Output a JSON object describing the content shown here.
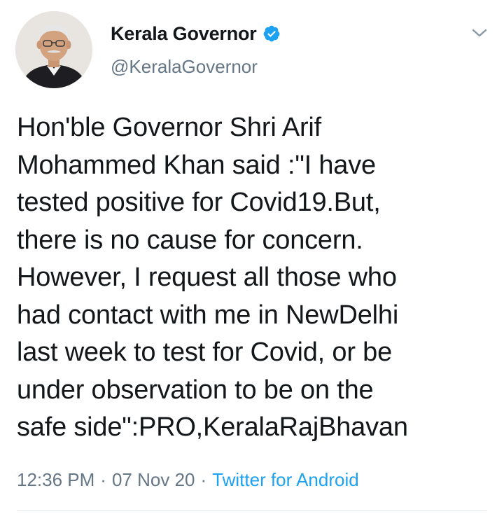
{
  "tweet": {
    "author": {
      "display_name": "Kerala Governor",
      "handle": "@KeralaGovernor",
      "verified": true,
      "avatar_icon": "profile-photo"
    },
    "text": "Hon'ble Governor Shri Arif\nMohammed Khan said :\"I have\ntested positive for Covid19.But,\nthere is no cause for concern.\nHowever, I request all those who\nhad contact with me in NewDelhi\nlast week to test for Covid, or be\nunder observation to be on the\nsafe side\":PRO,KeralaRajBhavan",
    "meta": {
      "time": "12:36 PM",
      "separator": "·",
      "date": "07 Nov 20",
      "source": "Twitter for Android"
    }
  },
  "colors": {
    "text": "#14171a",
    "secondary": "#657786",
    "accent": "#1da1f2",
    "divider": "#e1e8ed"
  },
  "icons": {
    "verified": "verified-badge-icon",
    "more": "chevron-down-icon"
  }
}
